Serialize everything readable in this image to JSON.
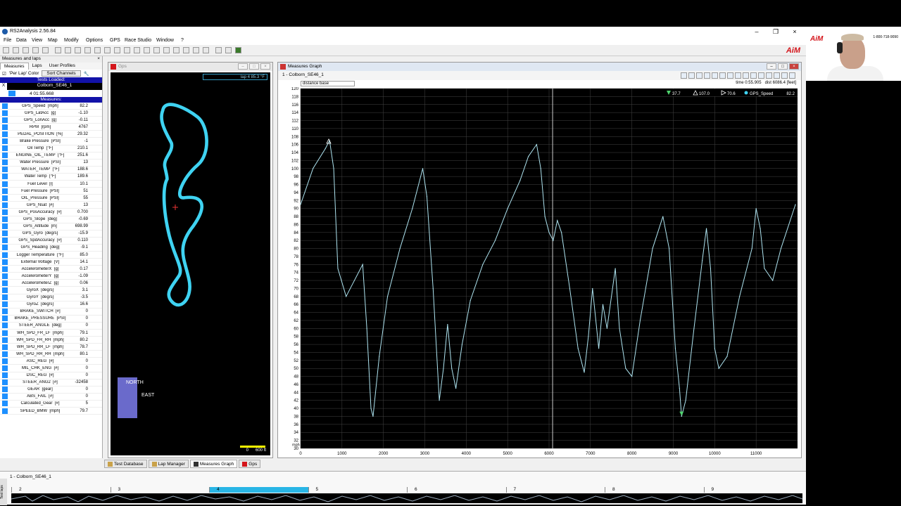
{
  "app": {
    "title": "RS2Analysis 2.56.84",
    "menu": [
      "File",
      "Data",
      "View",
      "Map",
      "Modify",
      "Options",
      "GPS",
      "Race Studio",
      "Window",
      "?"
    ],
    "logo": "AiM"
  },
  "left_panel": {
    "header": "Measures and laps",
    "close": "×",
    "tabs": [
      "Measures",
      "Laps",
      "User Profiles"
    ],
    "per_lap_color": "'Per Lap' Color",
    "sort_channels": "Sort Channels",
    "tests_loaded": "Tests Loaded:",
    "test_name": "Colborn_SE46_1",
    "test_x": "X",
    "lap_time": "4 01:55.668",
    "measures_header": "Measures:",
    "measures": [
      {
        "name": "GPS_Speed",
        "unit": "[mph]",
        "value": "82.2"
      },
      {
        "name": "GPS_LatAcc",
        "unit": "[g]",
        "value": "-1.10"
      },
      {
        "name": "GPS_LonAcc",
        "unit": "[g]",
        "value": "-0.11"
      },
      {
        "name": "RPM",
        "unit": "[rpm]",
        "value": "4767"
      },
      {
        "name": "PEDAL_POSITION",
        "unit": "[%]",
        "value": "29.32"
      },
      {
        "name": "Brake Pressure",
        "unit": "[PSI]",
        "value": "-1"
      },
      {
        "name": "Oil Temp",
        "unit": "[°F]",
        "value": "210.1"
      },
      {
        "name": "ENGINE_OIL_TEMP",
        "unit": "[°F]",
        "value": "251.6"
      },
      {
        "name": "Water Pressure",
        "unit": "[PSI]",
        "value": "13"
      },
      {
        "name": "WATER_TEMP",
        "unit": "[°F]",
        "value": "188.6"
      },
      {
        "name": "Water Temp",
        "unit": "[°F]",
        "value": "189.6"
      },
      {
        "name": "Fuel Level",
        "unit": "[l]",
        "value": "10.1"
      },
      {
        "name": "Fuel Pressure",
        "unit": "[PSI]",
        "value": "51"
      },
      {
        "name": "OIL_Pressure",
        "unit": "[PSI]",
        "value": "55"
      },
      {
        "name": "GPS_Nsat",
        "unit": "[#]",
        "value": "13"
      },
      {
        "name": "GPS_PosAccuracy",
        "unit": "[#]",
        "value": "0.700"
      },
      {
        "name": "GPS_Slope",
        "unit": "[deg]",
        "value": "-0.69"
      },
      {
        "name": "GPS_Altitude",
        "unit": "[m]",
        "value": "698.99"
      },
      {
        "name": "GPS_Gyro",
        "unit": "[deg/s]",
        "value": "-15.9"
      },
      {
        "name": "GPS_SpdAccuracy",
        "unit": "[#]",
        "value": "0.110"
      },
      {
        "name": "GPS_Heading",
        "unit": "[deg]",
        "value": "-9.1"
      },
      {
        "name": "Logger Temperature",
        "unit": "[°F]",
        "value": "85.0"
      },
      {
        "name": "External Voltage",
        "unit": "[V]",
        "value": "14.1"
      },
      {
        "name": "AccelerometerX",
        "unit": "[g]",
        "value": "0.17"
      },
      {
        "name": "AccelerometerY",
        "unit": "[g]",
        "value": "-1.09"
      },
      {
        "name": "AccelerometerZ",
        "unit": "[g]",
        "value": "0.06"
      },
      {
        "name": "GyroX",
        "unit": "[deg/s]",
        "value": "3.1"
      },
      {
        "name": "GyroY",
        "unit": "[deg/s]",
        "value": "-3.5"
      },
      {
        "name": "GyroZ",
        "unit": "[deg/s]",
        "value": "16.6"
      },
      {
        "name": "BRAKE_SWITCH",
        "unit": "[#]",
        "value": "0"
      },
      {
        "name": "BRAKE_PRESSURE",
        "unit": "[PSI]",
        "value": "0"
      },
      {
        "name": "STEER_ANGLE",
        "unit": "[deg]",
        "value": "0"
      },
      {
        "name": "WH_SPD_FR_LF",
        "unit": "[mph]",
        "value": "79.1"
      },
      {
        "name": "WH_SPD_FR_RH",
        "unit": "[mph]",
        "value": "80.2"
      },
      {
        "name": "WH_SPD_RR_LF",
        "unit": "[mph]",
        "value": "78.7"
      },
      {
        "name": "WH_SPD_RR_RH",
        "unit": "[mph]",
        "value": "80.1"
      },
      {
        "name": "ASC_REG",
        "unit": "[#]",
        "value": "0"
      },
      {
        "name": "MIL_CHK_ENG",
        "unit": "[#]",
        "value": "0"
      },
      {
        "name": "DSC_REG",
        "unit": "[#]",
        "value": "0"
      },
      {
        "name": "STEER_ANG2",
        "unit": "[#]",
        "value": "-32458"
      },
      {
        "name": "GEAR",
        "unit": "[gear]",
        "value": "0"
      },
      {
        "name": "ABS_FAIL",
        "unit": "[#]",
        "value": "0"
      },
      {
        "name": "Calculated_Gear",
        "unit": "[#]",
        "value": "5"
      },
      {
        "name": "SPEED_BMW",
        "unit": "[mph]",
        "value": "79.7"
      }
    ]
  },
  "gps_window": {
    "title": "Gps",
    "lap_box": "lap 4   85.3 °F",
    "north": "NORTH",
    "east": "EAST",
    "scale_0": "0",
    "scale_600": "600 ft",
    "track_color": "#3fd3f2"
  },
  "graph_window": {
    "title": "Measures Graph",
    "tab": "1 - Colborn_SE46_1",
    "distance_base": "distance base",
    "time_readout": "time 0:55.905",
    "dist_readout": "dist 6086.4 [feet]",
    "marker_min": "37.7",
    "marker_max": "107.0",
    "marker_delta": "70.6",
    "channel_name": "GPS_Speed",
    "channel_value": "82.2",
    "y_unit": "mph"
  },
  "chart_data": {
    "type": "line",
    "xlabel": "",
    "ylabel": "mph",
    "xlim": [
      0,
      12000
    ],
    "ylim": [
      30,
      120
    ],
    "x_ticks": [
      "0",
      "1000",
      "2000",
      "3000",
      "4000",
      "5000",
      "6000",
      "7000",
      "8000",
      "9000",
      "10000",
      "11000"
    ],
    "y_ticks": [
      "30",
      "32",
      "34",
      "36",
      "38",
      "40",
      "42",
      "44",
      "46",
      "48",
      "50",
      "52",
      "54",
      "56",
      "58",
      "60",
      "62",
      "64",
      "66",
      "68",
      "70",
      "72",
      "74",
      "76",
      "78",
      "80",
      "82",
      "84",
      "86",
      "88",
      "90",
      "92",
      "94",
      "96",
      "98",
      "100",
      "102",
      "104",
      "106",
      "108",
      "110",
      "112",
      "114",
      "116",
      "118",
      "120"
    ],
    "cursor_x": 6086,
    "series": [
      {
        "name": "GPS_Speed",
        "color": "#aee4f0",
        "x": [
          0,
          300,
          600,
          700,
          800,
          900,
          1100,
          1300,
          1500,
          1600,
          1700,
          1750,
          1900,
          2100,
          2400,
          2700,
          2950,
          3050,
          3200,
          3350,
          3450,
          3550,
          3650,
          3750,
          3900,
          4100,
          4400,
          4700,
          5000,
          5300,
          5500,
          5700,
          5800,
          5900,
          6000,
          6100,
          6200,
          6300,
          6500,
          6700,
          6850,
          6950,
          7050,
          7200,
          7300,
          7400,
          7600,
          7700,
          7850,
          8000,
          8200,
          8500,
          8750,
          8900,
          9050,
          9150,
          9200,
          9300,
          9500,
          9700,
          9800,
          9900,
          10000,
          10100,
          10300,
          10600,
          10900,
          11000,
          11100,
          11200,
          11400,
          11600,
          11950
        ],
        "values": [
          91,
          100,
          105,
          107,
          100,
          75,
          68,
          72,
          76,
          60,
          40,
          38,
          53,
          68,
          80,
          90,
          100,
          93,
          70,
          42,
          50,
          61,
          50,
          45,
          56,
          67,
          76,
          82,
          90,
          97,
          103,
          106,
          100,
          88,
          84,
          82,
          87,
          84,
          70,
          55,
          49,
          58,
          70,
          55,
          66,
          60,
          75,
          60,
          50,
          48,
          62,
          80,
          88,
          80,
          55,
          45,
          38,
          42,
          60,
          77,
          85,
          75,
          55,
          50,
          53,
          68,
          80,
          90,
          85,
          75,
          72,
          80,
          91
        ]
      }
    ]
  },
  "bottom_tabs": [
    "Test Database",
    "Lap Manager",
    "Measures Graph",
    "Gps"
  ],
  "lap_strip": {
    "test_label": "1 - Colborn_SE46_1",
    "side_label": "Test laps",
    "laps": [
      "2",
      "3",
      "4",
      "5",
      "6",
      "7",
      "8",
      "9"
    ],
    "active_lap": "4"
  },
  "webcam": {
    "brand": "AiM",
    "phone": "1-800-718-9090"
  }
}
